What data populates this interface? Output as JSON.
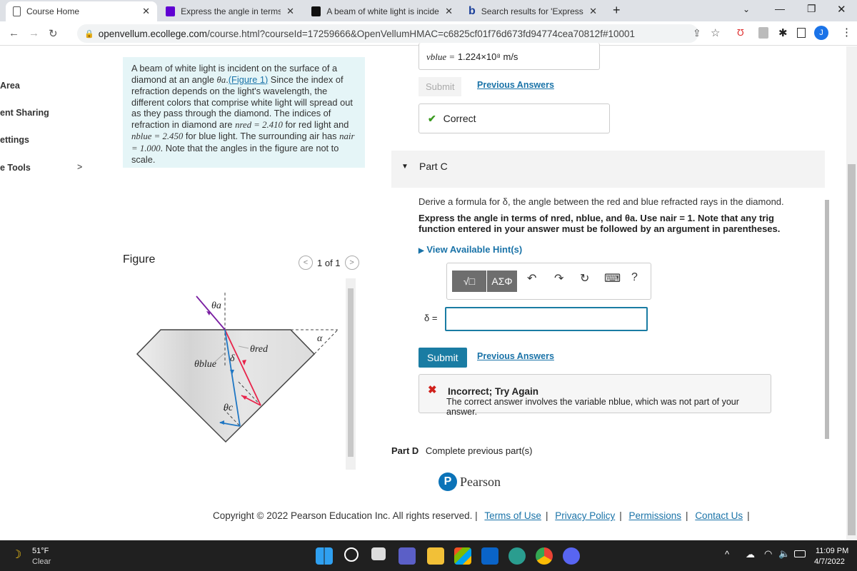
{
  "browser": {
    "tabs": [
      {
        "title": "Course Home",
        "active": true
      },
      {
        "title": "Express the angle in terms of nre"
      },
      {
        "title": "A beam of white light is incident"
      },
      {
        "title": "Search results for 'Express the an"
      }
    ],
    "new_tab": "+",
    "url_domain": "openvellum.ecollege.com",
    "url_path": "/course.html?courseId=17259666&OpenVellumHMAC=c6825cf01f76d673fd94774cea70812f#10001",
    "profile_initial": "J"
  },
  "sidebar": {
    "items": [
      "Area",
      "ent Sharing",
      "ettings",
      "e Tools"
    ],
    "chevron": ">"
  },
  "problem": {
    "p1": "A beam of white light is incident on the surface of a diamond at an angle ",
    "theta_a": "θa",
    "figure_link": "(Figure 1)",
    "p2": " Since the index of refraction depends on the light's wavelength, the different colors that comprise white light will spread out as they pass through the diamond. The indices of refraction in diamond are ",
    "n_red": "nred = 2.410",
    "p3": " for red light and ",
    "n_blue": "nblue = 2.450",
    "p4": " for blue light. The surrounding air has ",
    "n_air": "nair = 1.000",
    "p5": ". Note that the angles in the figure are not to scale."
  },
  "figure": {
    "label": "Figure",
    "pager": "1 of 1",
    "labels": {
      "theta_a": "θa",
      "theta_red": "θred",
      "theta_blue": "θblue",
      "delta": "δ",
      "theta_c": "θc",
      "alpha": "α"
    }
  },
  "part_b": {
    "answer_var": "vblue =",
    "answer_value": "1.224×10⁸ m/s",
    "submit": "Submit",
    "previous": "Previous Answers",
    "correct": "Correct"
  },
  "part_c": {
    "title": "Part C",
    "question": "Derive a formula for δ, the angle between the red and blue refracted rays in the diamond.",
    "instruction": "Express the angle in terms of nred, nblue, and θa. Use nair = 1. Note that any trig function entered in your answer must be followed by an argument in parentheses.",
    "hints": "View Available Hint(s)",
    "toolbar": {
      "templates": "√□",
      "greek": "ΑΣΦ",
      "undo": "↶",
      "redo": "↷",
      "reset": "↻",
      "keyboard": "⌨",
      "help": "?"
    },
    "answer_label": "δ =",
    "answer_value": "",
    "submit": "Submit",
    "previous": "Previous Answers",
    "feedback_title": "Incorrect; Try Again",
    "feedback_body": "The correct answer involves the variable nblue, which was not part of your answer."
  },
  "part_d": {
    "title": "Part D",
    "status": "Complete previous part(s)"
  },
  "footer": {
    "brand": "Pearson",
    "copyright": "Copyright © 2022 Pearson Education Inc. All rights reserved. |",
    "links": [
      "Terms of Use",
      "Privacy Policy",
      "Permissions",
      "Contact Us"
    ]
  },
  "taskbar": {
    "weather_temp": "51°F",
    "weather_desc": "Clear",
    "time": "11:09 PM",
    "date": "4/7/2022"
  },
  "colors": {
    "accent": "#1a7ca3",
    "intro_bg": "#e5f5f7",
    "red_ray": "#e8234a",
    "blue_ray": "#1f77c4",
    "incident_ray": "#7a1fa2",
    "correct": "#3a9a1f",
    "incorrect": "#d0211c"
  }
}
